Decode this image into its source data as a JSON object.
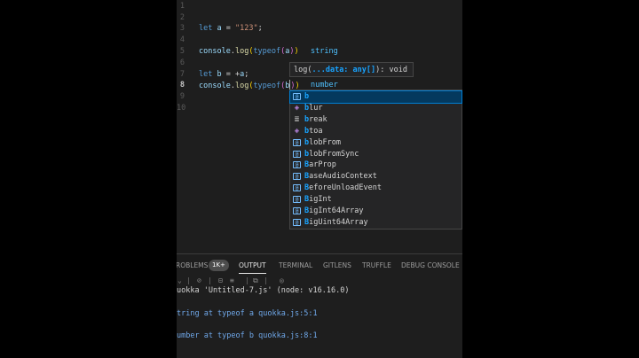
{
  "editor": {
    "line_numbers": [
      "1",
      "2",
      "3",
      "4",
      "5",
      "6",
      "7",
      "8",
      "9",
      "10"
    ],
    "active_line": "8",
    "line3": {
      "kw": "let",
      "var": "a",
      "op": " = ",
      "str": "\"123\"",
      "end": ";"
    },
    "line5": {
      "obj": "console",
      "dot": ".",
      "fn": "log",
      "open": "(",
      "kw": "typeof",
      "popen": "(",
      "var": "a",
      "pclose": ")",
      "close": ")",
      "value": "string"
    },
    "line7": {
      "kw": "let",
      "var": "b",
      "op": " = +",
      "var2": "a",
      "end": ";"
    },
    "line8": {
      "obj": "console",
      "dot": ".",
      "fn": "log",
      "open": "(",
      "kw": "typeof",
      "popen": "(",
      "var": "b",
      "pclose": ")",
      "close": ")",
      "value": "number"
    }
  },
  "signature_help": {
    "prefix": "log(",
    "param": "...data: any[]",
    "suffix": "): void"
  },
  "suggestions": [
    {
      "icon": "variable",
      "match": "b",
      "rest": ""
    },
    {
      "icon": "method",
      "match": "b",
      "rest": "lur"
    },
    {
      "icon": "keyword",
      "match": "b",
      "rest": "reak"
    },
    {
      "icon": "method",
      "match": "b",
      "rest": "toa"
    },
    {
      "icon": "variable",
      "match": "b",
      "rest": "lobFrom"
    },
    {
      "icon": "variable",
      "match": "b",
      "rest": "lobFromSync"
    },
    {
      "icon": "variable",
      "match": "B",
      "rest": "arProp"
    },
    {
      "icon": "variable",
      "match": "B",
      "rest": "aseAudioContext"
    },
    {
      "icon": "variable",
      "match": "B",
      "rest": "eforeUnloadEvent"
    },
    {
      "icon": "variable",
      "match": "B",
      "rest": "igInt"
    },
    {
      "icon": "variable",
      "match": "B",
      "rest": "igInt64Array"
    },
    {
      "icon": "variable",
      "match": "B",
      "rest": "igUint64Array"
    }
  ],
  "panel": {
    "tabs": [
      "ROBLEMS",
      "OUTPUT",
      "TERMINAL",
      "GITLENS",
      "TRUFFLE",
      "DEBUG CONSOLE"
    ],
    "badge": "1K+",
    "output_lines": [
      "uokka 'Untitled-7.js' (node: v16.16.0)",
      "tring at typeof a quokka.js:5:1",
      "umber at typeof b quokka.js:8:1"
    ]
  },
  "colors": {
    "editor_bg": "#1e1e1e",
    "selection": "#04395e",
    "accent": "#007fd4",
    "keyword": "#c586c0",
    "string": "#ce9178",
    "inline_value": "#4fc1ff"
  }
}
